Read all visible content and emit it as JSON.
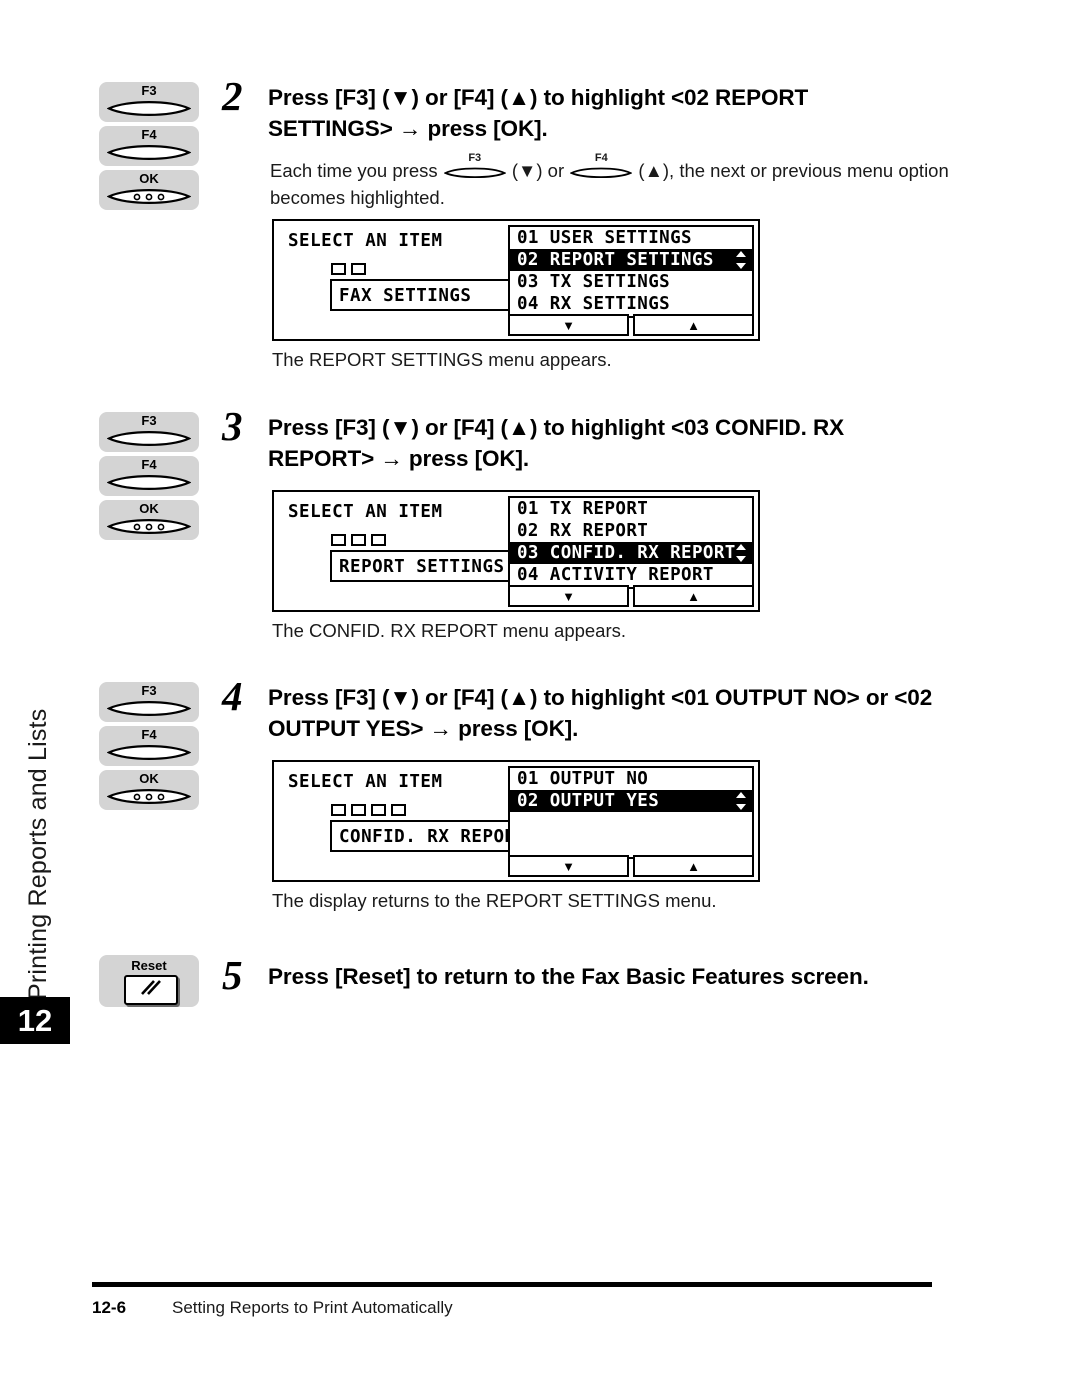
{
  "sidebar": {
    "running_head": "Printing Reports and Lists",
    "chapter_number": "12"
  },
  "footer": {
    "page_number": "12-6",
    "section_title": "Setting Reports to Print Automatically"
  },
  "steps": [
    {
      "number": "2",
      "keys": [
        {
          "label": "F3",
          "icon": "function-key-f3-icon"
        },
        {
          "label": "F4",
          "icon": "function-key-f4-icon"
        },
        {
          "label": "OK",
          "icon": "ok-key-icon"
        }
      ],
      "heading_line1": "Press [F3] (▼) or [F4] (▲) to highlight <02 REPORT",
      "heading_line2": "SETTINGS> → press [OK].",
      "subtext_a": "Each time you press",
      "subtext_key1": "F3",
      "subtext_b": "(▼) or",
      "subtext_key2": "F4",
      "subtext_c": "(▲), the next or previous menu option",
      "subtext_d": "becomes highlighted.",
      "lcd": {
        "title": "SELECT AN ITEM",
        "crumb_count": 2,
        "context": "FAX SETTINGS",
        "items": [
          {
            "text": "01 USER SETTINGS",
            "selected": false
          },
          {
            "text": "02 REPORT SETTINGS",
            "selected": true
          },
          {
            "text": "03 TX SETTINGS",
            "selected": false
          },
          {
            "text": "04 RX SETTINGS",
            "selected": false
          }
        ],
        "button_down": "▼",
        "button_up": "▲"
      },
      "caption": "The REPORT SETTINGS menu appears."
    },
    {
      "number": "3",
      "keys": [
        {
          "label": "F3",
          "icon": "function-key-f3-icon"
        },
        {
          "label": "F4",
          "icon": "function-key-f4-icon"
        },
        {
          "label": "OK",
          "icon": "ok-key-icon"
        }
      ],
      "heading_line1": "Press [F3] (▼) or [F4] (▲) to highlight <03 CONFID. RX",
      "heading_line2": "REPORT> → press [OK].",
      "lcd": {
        "title": "SELECT AN ITEM",
        "crumb_count": 3,
        "context": "REPORT SETTINGS",
        "items": [
          {
            "text": "01 TX REPORT",
            "selected": false
          },
          {
            "text": "02 RX REPORT",
            "selected": false
          },
          {
            "text": "03 CONFID. RX REPORT",
            "selected": true
          },
          {
            "text": "04 ACTIVITY REPORT",
            "selected": false
          }
        ],
        "button_down": "▼",
        "button_up": "▲"
      },
      "caption": "The CONFID. RX REPORT menu appears."
    },
    {
      "number": "4",
      "keys": [
        {
          "label": "F3",
          "icon": "function-key-f3-icon"
        },
        {
          "label": "F4",
          "icon": "function-key-f4-icon"
        },
        {
          "label": "OK",
          "icon": "ok-key-icon"
        }
      ],
      "heading_line1": "Press [F3] (▼) or [F4] (▲) to highlight <01 OUTPUT NO> or <02",
      "heading_line2": "OUTPUT YES> → press [OK].",
      "lcd": {
        "title": "SELECT AN ITEM",
        "crumb_count": 4,
        "context": "CONFID. RX REPORT",
        "items": [
          {
            "text": "01 OUTPUT NO",
            "selected": false
          },
          {
            "text": "02 OUTPUT YES",
            "selected": true
          },
          {
            "text": "",
            "selected": false
          },
          {
            "text": "",
            "selected": false
          }
        ],
        "button_down": "▼",
        "button_up": "▲"
      },
      "caption": "The display returns to the REPORT SETTINGS menu."
    },
    {
      "number": "5",
      "keys": [
        {
          "label": "Reset",
          "icon": "reset-key-icon"
        }
      ],
      "heading_line1": "Press [Reset] to return to the Fax Basic Features screen.",
      "heading_line2": ""
    }
  ]
}
